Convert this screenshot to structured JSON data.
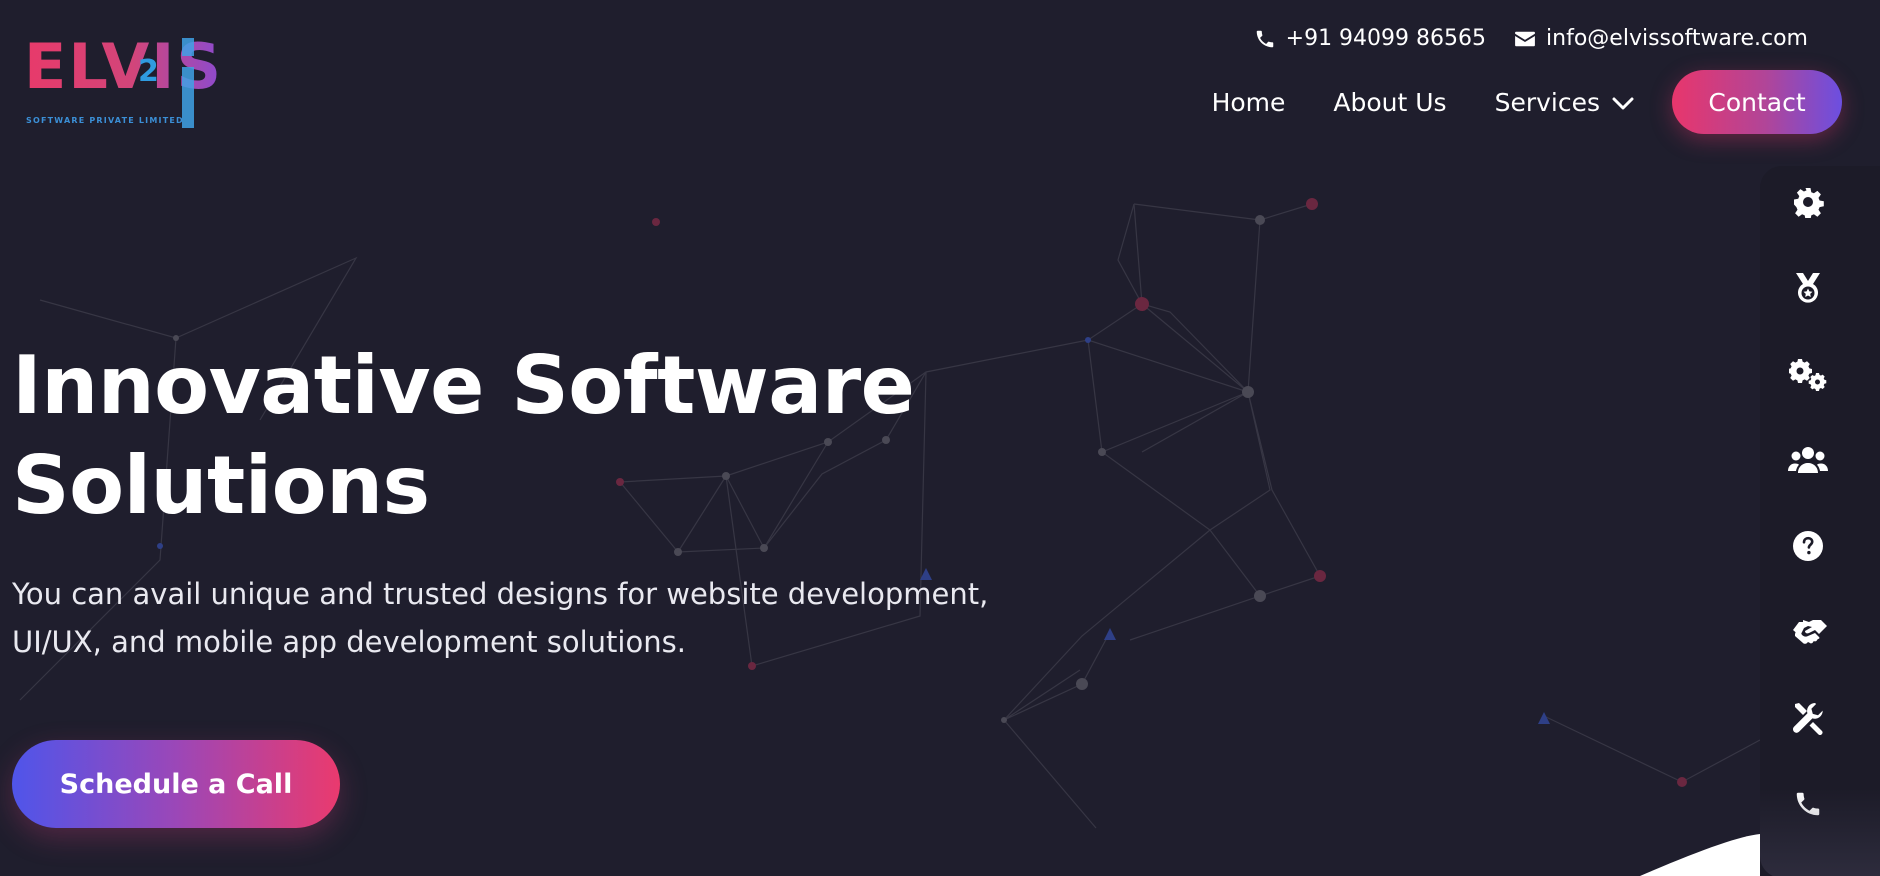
{
  "brand": {
    "logo_text": "ELVIS",
    "logo_sup": "2",
    "logo_tagline": "SOFTWARE PRIVATE LIMITED"
  },
  "top_contact": {
    "phone": "+91 94099 86565",
    "email": "info@elvissoftware.com"
  },
  "nav": {
    "items": [
      {
        "label": "Home"
      },
      {
        "label": "About Us"
      },
      {
        "label": "Services"
      }
    ],
    "contact_label": "Contact"
  },
  "hero": {
    "title_line1": "Innovative Software",
    "title_line2": "Solutions",
    "subtitle_line1": "You can avail unique and trusted designs for website development,",
    "subtitle_line2": "UI/UX, and mobile app development solutions.",
    "cta_label": "Schedule a Call"
  },
  "side_rail": {
    "icons": [
      "gear-icon",
      "award-medal-icon",
      "gears-icon",
      "users-icon",
      "question-circle-icon",
      "handshake-icon",
      "tools-icon",
      "phone-icon"
    ]
  },
  "colors": {
    "background": "#1f1e2d",
    "accent_pink": "#e8366c",
    "accent_blue": "#4f55ea",
    "accent_purple": "#9b47b8"
  }
}
